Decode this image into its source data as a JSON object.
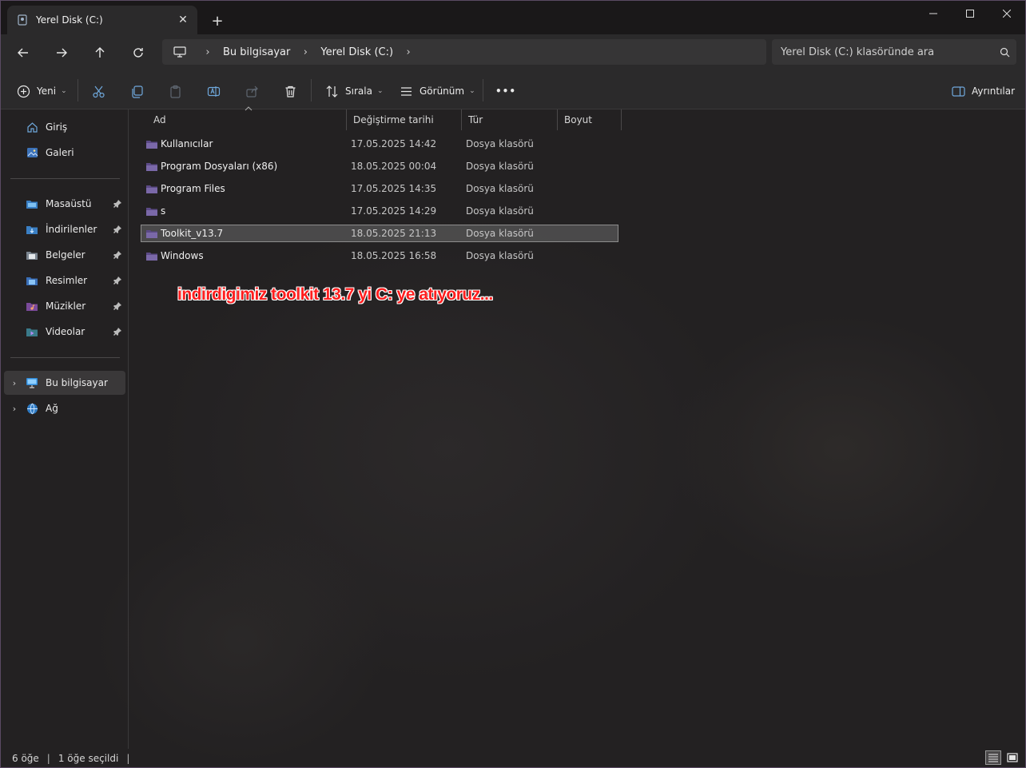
{
  "tab": {
    "title": "Yerel Disk (C:)",
    "close": "✕",
    "new_tab": "+"
  },
  "nav": {
    "breadcrumb": [
      "Bu bilgisayar",
      "Yerel Disk (C:)"
    ],
    "search_placeholder": "Yerel Disk (C:) klasöründe ara"
  },
  "commands": {
    "new": "Yeni",
    "sort": "Sırala",
    "view": "Görünüm",
    "more": "•••",
    "details": "Ayrıntılar"
  },
  "sidebar": {
    "top": [
      {
        "label": "Giriş",
        "icon": "home-icon"
      },
      {
        "label": "Galeri",
        "icon": "gallery-icon"
      }
    ],
    "pinned": [
      {
        "label": "Masaüstü",
        "icon": "desktop-folder-icon",
        "color": "#4aa3e0"
      },
      {
        "label": "İndirilenler",
        "icon": "downloads-folder-icon",
        "color": "#3f8fd0"
      },
      {
        "label": "Belgeler",
        "icon": "documents-folder-icon",
        "color": "#8a8f95"
      },
      {
        "label": "Resimler",
        "icon": "pictures-folder-icon",
        "color": "#3a84d8"
      },
      {
        "label": "Müzikler",
        "icon": "music-folder-icon",
        "color": "#d06a3a"
      },
      {
        "label": "Videolar",
        "icon": "videos-folder-icon",
        "color": "#8a4ad0"
      }
    ],
    "bottom": [
      {
        "label": "Bu bilgisayar",
        "icon": "this-pc-icon"
      },
      {
        "label": "Ağ",
        "icon": "network-icon"
      }
    ]
  },
  "columns": {
    "name": "Ad",
    "date": "Değiştirme tarihi",
    "type": "Tür",
    "size": "Boyut"
  },
  "files": [
    {
      "name": "Kullanıcılar",
      "date": "17.05.2025 14:42",
      "type": "Dosya klasörü",
      "size": ""
    },
    {
      "name": "Program Dosyaları (x86)",
      "date": "18.05.2025 00:04",
      "type": "Dosya klasörü",
      "size": ""
    },
    {
      "name": "Program Files",
      "date": "17.05.2025 14:35",
      "type": "Dosya klasörü",
      "size": ""
    },
    {
      "name": "s",
      "date": "17.05.2025 14:29",
      "type": "Dosya klasörü",
      "size": ""
    },
    {
      "name": "Toolkit_v13.7",
      "date": "18.05.2025 21:13",
      "type": "Dosya klasörü",
      "size": ""
    },
    {
      "name": "Windows",
      "date": "18.05.2025 16:58",
      "type": "Dosya klasörü",
      "size": ""
    }
  ],
  "annotation": "indirdigimiz toolkit 13.7 yi C: ye atıyoruz...",
  "status": {
    "count": "6 öğe",
    "selected": "1 öğe seçildi",
    "sep": "|"
  },
  "colors": {
    "folder": "#5b4a86",
    "folder_light": "#7a68a8",
    "annotation": "#ff1e1e",
    "selection": "#8d8d8d"
  }
}
